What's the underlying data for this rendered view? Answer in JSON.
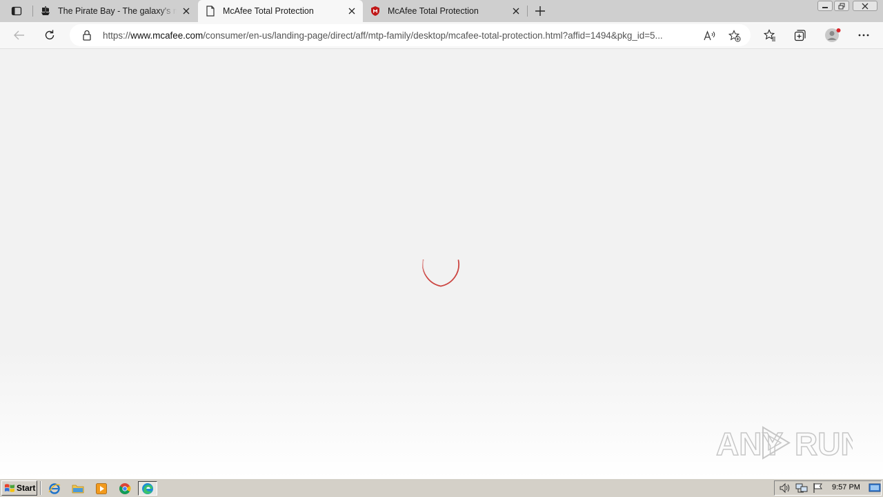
{
  "tabs": [
    {
      "title": "The Pirate Bay - The galaxy's most resilient BitTorrent site",
      "favicon": "pirate-ship-icon",
      "active": false
    },
    {
      "title": "McAfee Total Protection",
      "favicon": "page-icon",
      "active": true
    },
    {
      "title": "McAfee Total Protection",
      "favicon": "mcafee-shield-icon",
      "active": false
    }
  ],
  "address": {
    "scheme": "https://",
    "host": "www.mcafee.com",
    "path": "/consumer/en-us/landing-page/direct/aff/mtp-family/desktop/mcafee-total-protection.html?affid=1494&pkg_id=5..."
  },
  "content": {
    "state": "loading",
    "spinner_color": "#c8322e",
    "watermark": "ANY RUN"
  },
  "taskbar": {
    "start_label": "Start",
    "clock": "9:57 PM"
  },
  "colors": {
    "tabstrip": "#cfcfcf",
    "toolbar": "#f7f7f7",
    "page_bg": "#f2f2f2",
    "taskbar": "#d4d0c8",
    "mcafee_red": "#c01818"
  }
}
